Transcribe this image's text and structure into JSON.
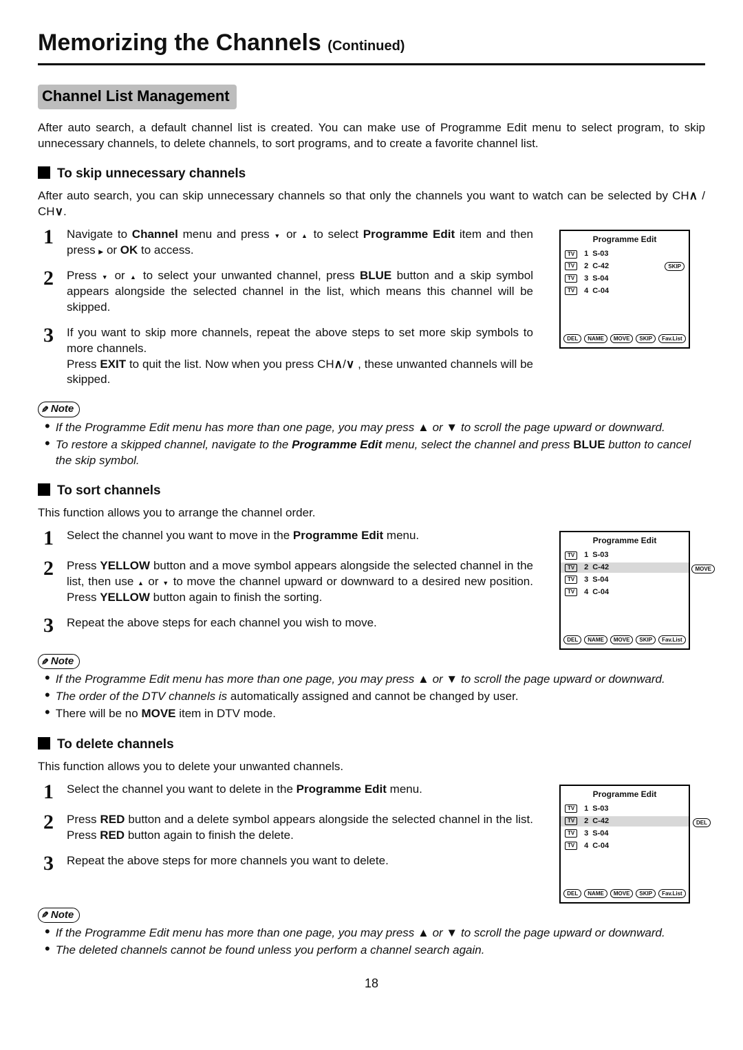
{
  "page_title_main": "Memorizing the Channels",
  "page_title_cont": "(Continued)",
  "section_heading": "Channel List Management",
  "intro": "After auto search, a default channel list is created. You can make use of Programme Edit menu to select program, to skip unnecessary channels, to delete channels, to sort programs, and to create a favorite channel list.",
  "skip": {
    "heading": "To skip unnecessary channels",
    "intro_a": "After auto search, you can skip unnecessary channels so that only the channels you want to watch can be selected by CH",
    "intro_b": " / CH",
    "intro_c": ".",
    "step1_a": "Navigate to ",
    "step1_b": "Channel",
    "step1_c": " menu and press ",
    "step1_d": " or ",
    "step1_e": " to select ",
    "step1_f": "Programme Edit",
    "step1_g": " item and then press ",
    "step1_h": " or ",
    "step1_i": "OK",
    "step1_j": " to access.",
    "step2_a": "Press ",
    "step2_b": " or ",
    "step2_c": " to select your unwanted channel, press ",
    "step2_d": "BLUE",
    "step2_e": " button and a skip symbol appears alongside the selected channel in the list, which means this channel will be skipped.",
    "step3_a": "If you want to skip more channels, repeat the above steps to set more skip symbols to more channels.",
    "step3_b": "Press ",
    "step3_c": "EXIT",
    "step3_d": " to quit the list. Now when you press CH",
    "step3_e": "/",
    "step3_f": " ,  these unwanted channels will be skipped.",
    "note1": "If the Programme Edit menu has more than one page, you may press ▲ or ▼  to scroll the page upward or downward.",
    "note2_a": "To restore a skipped channel, navigate to the ",
    "note2_b": "Programme Edit",
    "note2_c": " menu, select the channel and press ",
    "note2_d": "BLUE",
    "note2_e": " button to cancel the skip symbol."
  },
  "sort": {
    "heading": "To sort channels",
    "intro": "This function allows you to arrange the channel order.",
    "step1_a": "Select the channel you want to move in the ",
    "step1_b": "Programme Edit",
    "step1_c": " menu.",
    "step2_a": "Press ",
    "step2_b": "YELLOW",
    "step2_c": " button and a move symbol appears alongside the selected channel in the list, then use ",
    "step2_d": " or ",
    "step2_e": " to move the channel upward or downward to a desired new position. Press ",
    "step2_f": "YELLOW",
    "step2_g": " button again to finish the sorting.",
    "step3": "Repeat the above steps for each channel you wish to move.",
    "note1": "If the Programme Edit menu has more than one page, you may press ▲ or ▼  to scroll the page upward or downward.",
    "note2_a": "The order of the DTV channels is",
    "note2_b": " automatically assigned and cannot be changed by user.",
    "note3_a": "There will be no ",
    "note3_b": "MOVE",
    "note3_c": " item in DTV mode."
  },
  "del": {
    "heading": "To delete channels",
    "intro": "This function allows you to delete your unwanted channels.",
    "step1_a": "Select the channel you want to delete in the ",
    "step1_b": "Programme Edit",
    "step1_c": " menu.",
    "step2_a": "Press ",
    "step2_b": "RED",
    "step2_c": " button and a delete symbol appears alongside the selected channel in the list. Press  ",
    "step2_d": "RED",
    "step2_e": " button again to finish the delete.",
    "step3": "Repeat the above steps for more channels you want to delete.",
    "note1": "If the Programme Edit menu has more than one page, you may press ▲ or ▼  to scroll the page upward or downward.",
    "note2": "The deleted channels cannot be found unless you perform a channel search again."
  },
  "osd": {
    "title": "Programme Edit",
    "rows": [
      {
        "n": "1",
        "ch": "S-03"
      },
      {
        "n": "2",
        "ch": "C-42"
      },
      {
        "n": "3",
        "ch": "S-04"
      },
      {
        "n": "4",
        "ch": "C-04"
      }
    ],
    "footer": [
      "DEL",
      "NAME",
      "MOVE",
      "SKIP",
      "Fav.List"
    ],
    "tv": "TV",
    "skip_tag": "SKIP",
    "move_tag": "MOVE",
    "del_tag": "DEL"
  },
  "note_label": "Note",
  "page_number": "18"
}
